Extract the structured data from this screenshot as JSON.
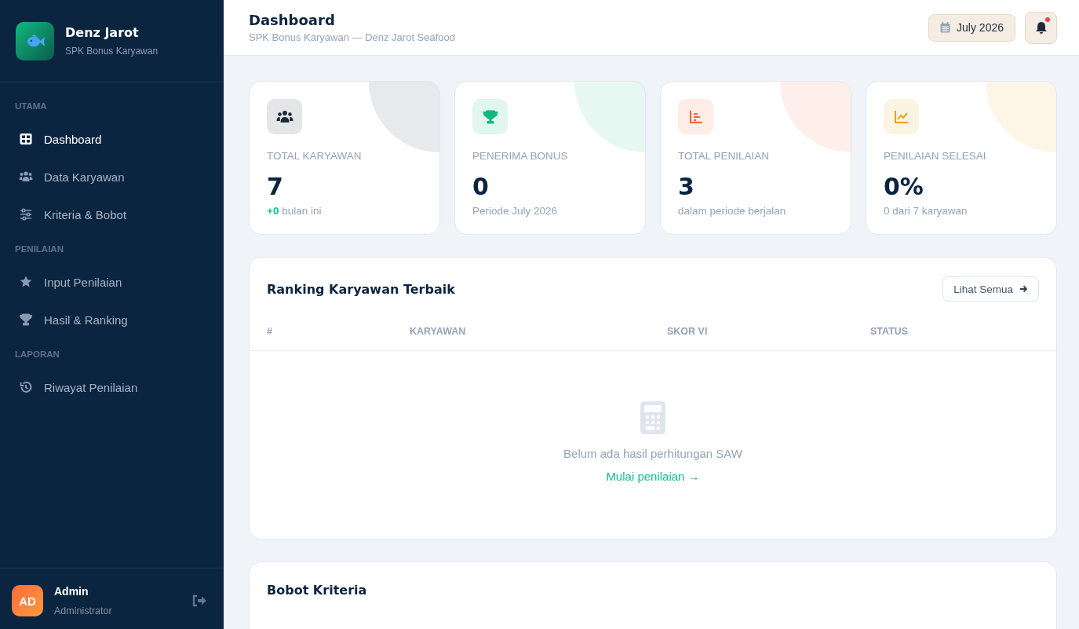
{
  "brand": {
    "name": "Denz Jarot",
    "subtitle": "SPK Bonus Karyawan"
  },
  "sidebar": {
    "sections": [
      {
        "title": "UTAMA",
        "items": [
          {
            "label": "Dashboard",
            "selected": true
          },
          {
            "label": "Data Karyawan",
            "selected": false
          },
          {
            "label": "Kriteria & Bobot",
            "selected": false
          }
        ]
      },
      {
        "title": "PENILAIAN",
        "items": [
          {
            "label": "Input Penilaian",
            "selected": false
          },
          {
            "label": "Hasil & Ranking",
            "selected": false
          }
        ]
      },
      {
        "title": "LAPORAN",
        "items": [
          {
            "label": "Riwayat Penilaian",
            "selected": false
          }
        ]
      }
    ]
  },
  "user": {
    "initials": "AD",
    "name": "Admin",
    "role": "Administrator"
  },
  "header": {
    "title": "Dashboard",
    "subtitle": "SPK Bonus Karyawan — Denz Jarot Seafood",
    "period": "July 2026",
    "notification": true
  },
  "stats": [
    {
      "label": "TOTAL KARYAWAN",
      "value": "7",
      "note": "**+0** bulan ini",
      "color": "#1e293b"
    },
    {
      "label": "PENERIMA BONUS",
      "value": "0",
      "note": "Periode July 2026",
      "color": "#10b981"
    },
    {
      "label": "TOTAL PENILAIAN",
      "value": "3",
      "note": "dalam periode berjalan",
      "color": "#f4623a"
    },
    {
      "label": "PENILAIAN SELESAI",
      "value": "0%",
      "note": "0 dari 7 karyawan",
      "color": "#e8a317"
    }
  ],
  "ranking": {
    "title": "Ranking Karyawan Terbaik",
    "action": "Lihat Semua",
    "columns": [
      "#",
      "KARYAWAN",
      "SKOR VI",
      "STATUS"
    ],
    "empty_message": "Belum ada hasil perhitungan SAW",
    "empty_link": "Mulai penilaian →"
  },
  "weights": {
    "title": "Bobot Kriteria"
  }
}
